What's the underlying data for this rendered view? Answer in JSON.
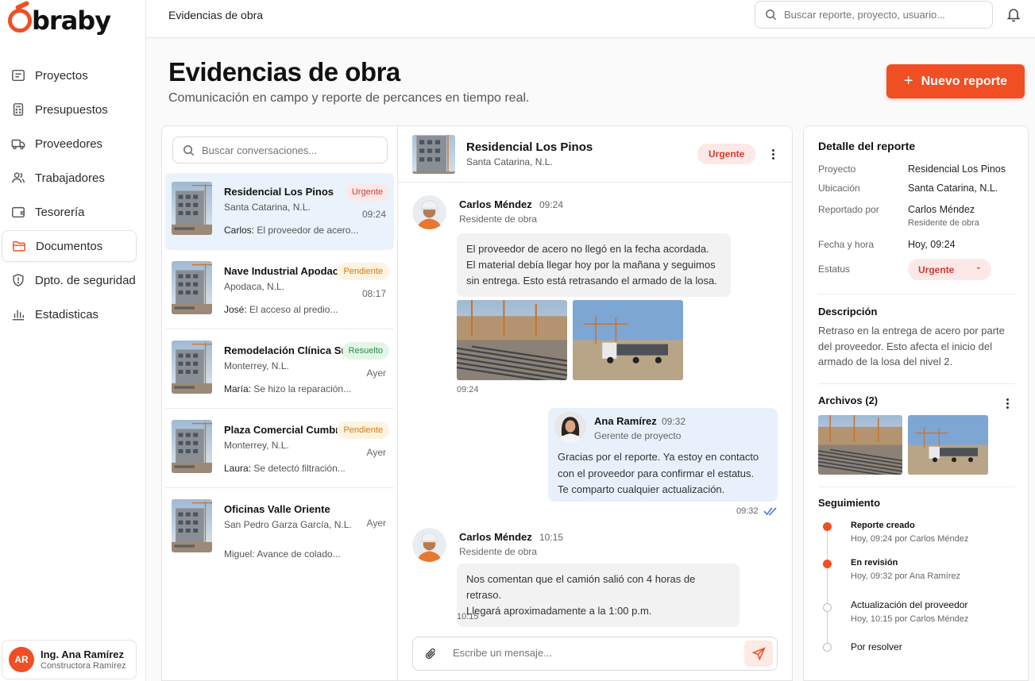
{
  "app": {
    "logo_text": "braby",
    "brand_color": "#f04e23"
  },
  "sidebar": {
    "items": [
      {
        "label": "Proyectos",
        "icon": "folder-icon"
      },
      {
        "label": "Presupuestos",
        "icon": "calculator-icon"
      },
      {
        "label": "Proveedores",
        "icon": "truck-icon"
      },
      {
        "label": "Trabajadores",
        "icon": "users-icon"
      },
      {
        "label": "Tesorería",
        "icon": "wallet-icon"
      },
      {
        "label": "Documentos",
        "icon": "folder-open-icon",
        "active": true
      },
      {
        "label": "Dpto. de seguridad",
        "icon": "shield-icon"
      },
      {
        "label": "Estadisticas",
        "icon": "bar-chart-icon"
      }
    ],
    "user": {
      "initials": "AR",
      "name": "Ing. Ana Ramírez",
      "company": "Constructora Ramírez"
    }
  },
  "topbar": {
    "title": "Evidencias de obra",
    "search_placeholder": "Buscar reporte, proyecto, usuario..."
  },
  "header": {
    "title": "Evidencias de obra",
    "subtitle": "Comunicación en campo y reporte de percances en tiempo real.",
    "new_button": "Nuevo reporte"
  },
  "conversations": {
    "search_placeholder": "Buscar conversaciones...",
    "items": [
      {
        "name": "Residencial Los Pinos",
        "location": "Santa Catarina, N.L.",
        "time": "09:24",
        "author": "Carlos:",
        "preview": "El proveedor de acero...",
        "badge": "Urgente"
      },
      {
        "name": "Nave Industrial Apodaca",
        "location": "Apodaca, N.L.",
        "time": "08:17",
        "author": "José:",
        "preview": "El acceso al predio...",
        "badge": "Pendiente"
      },
      {
        "name": "Remodelación Clínica Sur",
        "location": "Monterrey, N.L.",
        "time": "Ayer",
        "author": "María:",
        "preview": "Se hizo la reparación...",
        "badge": "Resuelto"
      },
      {
        "name": "Plaza Comercial Cumbres",
        "location": "Monterrey, N.L.",
        "time": "Ayer",
        "author": "Laura:",
        "preview": "Se detectó filtración...",
        "badge": "Pendiente"
      },
      {
        "name": "Oficinas Valle Oriente",
        "location": "San Pedro Garza García, N.L.",
        "time": "Ayer",
        "author": "Miguel:",
        "preview": "Avance de colado...",
        "badge": ""
      }
    ]
  },
  "chat": {
    "title": "Residencial Los Pinos",
    "location": "Santa Catarina, N.L.",
    "badge": "Urgente",
    "messages": [
      {
        "author": "Carlos Méndez",
        "time": "09:24",
        "role": "Residente de obra",
        "lines": [
          "El proveedor de acero no llegó en la fecha acordada.",
          "El material debía llegar hoy por la mañana y seguimos",
          "sin entrega. Esto está retrasando el armado de la losa."
        ],
        "stamp": "09:24"
      },
      {
        "author": "Ana Ramírez",
        "time": "09:32",
        "role": "Gerente de proyecto",
        "lines": [
          "Gracias por el reporte. Ya estoy en contacto",
          "con el proveedor para confirmar el estatus.",
          "Te comparto cualquier actualización."
        ],
        "stamp": "09:32"
      },
      {
        "author": "Carlos Méndez",
        "time": "10:15",
        "role": "Residente de obra",
        "lines": [
          "Nos comentan que el camión salió con 4 horas de retraso.",
          "Llegará aproximadamente a la 1:00 p.m."
        ],
        "stamp": "10:15"
      }
    ],
    "composer_placeholder": "Escribe un mensaje..."
  },
  "detail": {
    "title": "Detalle del reporte",
    "fields": {
      "proyecto_label": "Proyecto",
      "proyecto": "Residencial Los Pinos",
      "ubicacion_label": "Ubicación",
      "ubicacion": "Santa Catarina, N.L.",
      "reportado_label": "Reportado por",
      "reportado": "Carlos Méndez",
      "reportado_role": "Residente de obra",
      "fecha_label": "Fecha y hora",
      "fecha": "Hoy, 09:24",
      "estatus_label": "Estatus",
      "estatus": "Urgente"
    },
    "description_title": "Descripción",
    "description": "Retraso en la entrega de acero por parte del proveedor. Esto afecta el inicio del armado de la losa del nivel 2.",
    "files_title": "Archivos (2)",
    "tracking_title": "Seguimiento",
    "timeline": [
      {
        "title": "Reporte creado",
        "sub": "Hoy, 09:24 por Carlos Méndez",
        "state": "done"
      },
      {
        "title": "En revisión",
        "sub": "Hoy, 09:32 por Ana Ramírez",
        "state": "done"
      },
      {
        "title": "Actualización del proveedor",
        "sub": "Hoy, 10:15 por Carlos Méndez",
        "state": "pending"
      },
      {
        "title": "Por resolver",
        "sub": "",
        "state": "pending"
      }
    ]
  }
}
